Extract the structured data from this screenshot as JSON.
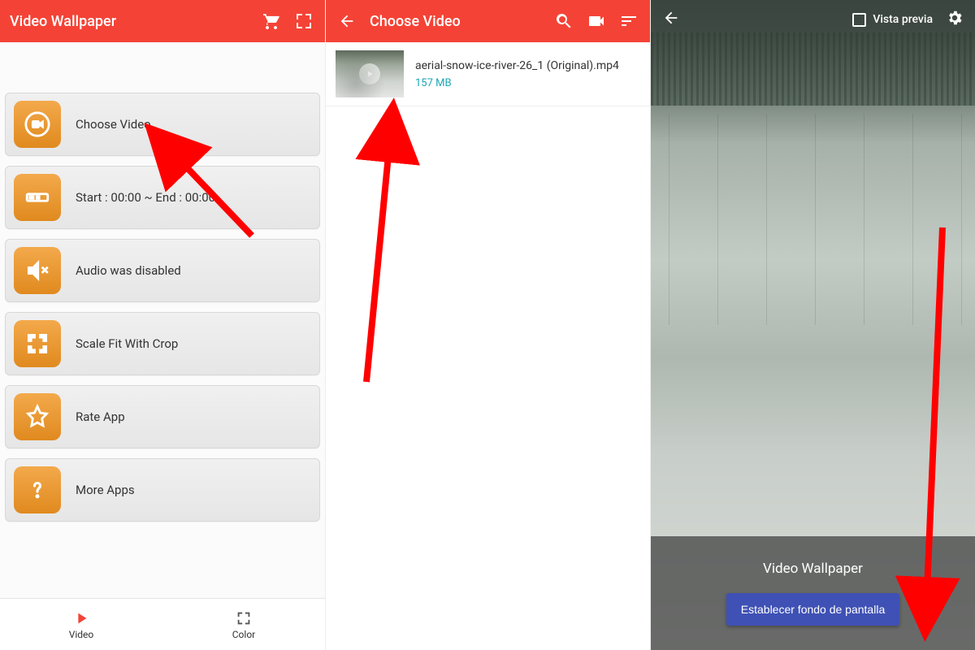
{
  "screen1": {
    "header_title": "Video Wallpaper",
    "menu": [
      {
        "label": "Choose Video"
      },
      {
        "label": "Start : 00:00 ~ End : 00:00"
      },
      {
        "label": "Audio was disabled"
      },
      {
        "label": "Scale Fit With Crop"
      },
      {
        "label": "Rate App"
      },
      {
        "label": "More Apps"
      }
    ],
    "tabs": {
      "video": "Video",
      "color": "Color"
    }
  },
  "screen2": {
    "header_title": "Choose Video",
    "video": {
      "name": "aerial-snow-ice-river-26_1 (Original).mp4",
      "size": "157 MB"
    }
  },
  "screen3": {
    "preview_label": "Vista previa",
    "footer_title": "Video Wallpaper",
    "set_button": "Establecer fondo de pantalla"
  }
}
